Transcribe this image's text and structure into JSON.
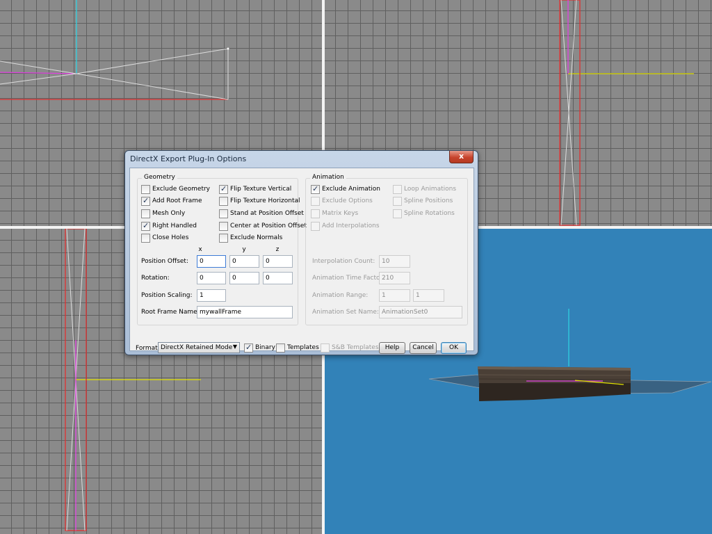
{
  "dialog": {
    "title": "DirectX Export Plug-In Options",
    "close_glyph": "x"
  },
  "geometry": {
    "label": "Geometry",
    "options": [
      {
        "label": "Exclude Geometry",
        "checked": false
      },
      {
        "label": "Add Root Frame",
        "checked": true
      },
      {
        "label": "Mesh Only",
        "checked": false
      },
      {
        "label": "Right Handled",
        "checked": true
      },
      {
        "label": "Close Holes",
        "checked": false
      },
      {
        "label": "Flip Texture Vertical",
        "checked": true
      },
      {
        "label": "Flip Texture Horizontal",
        "checked": false
      },
      {
        "label": "Stand at Position Offset",
        "checked": false
      },
      {
        "label": "Center at Position Offset",
        "checked": false
      },
      {
        "label": "Exclude Normals",
        "checked": false
      }
    ],
    "axes": {
      "x": "x",
      "y": "y",
      "z": "z"
    },
    "position_offset": {
      "label": "Position Offset:",
      "x": "0",
      "y": "0",
      "z": "0"
    },
    "rotation": {
      "label": "Rotation:",
      "x": "0",
      "y": "0",
      "z": "0"
    },
    "position_scaling": {
      "label": "Position Scaling:",
      "value": "1"
    },
    "root_frame_name": {
      "label": "Root Frame Name:",
      "value": "mywallFrame"
    }
  },
  "animation": {
    "label": "Animation",
    "options": [
      {
        "label": "Exclude Animation",
        "checked": true,
        "enabled": true
      },
      {
        "label": "Exclude Options",
        "checked": false,
        "enabled": false
      },
      {
        "label": "Matrix Keys",
        "checked": false,
        "enabled": false
      },
      {
        "label": "Add Interpolations",
        "checked": false,
        "enabled": false
      },
      {
        "label": "Loop Animations",
        "checked": false,
        "enabled": false
      },
      {
        "label": "Spline Positions",
        "checked": false,
        "enabled": false
      },
      {
        "label": "Spline Rotations",
        "checked": false,
        "enabled": false
      }
    ],
    "interpolation_count": {
      "label": "Interpolation Count:",
      "value": "10"
    },
    "animation_time_factor": {
      "label": "Animation Time Factor:",
      "value": "210"
    },
    "animation_range": {
      "label": "Animation Range:",
      "start": "1",
      "end": "1"
    },
    "animation_set_name": {
      "label": "Animation Set Name:",
      "value": "AnimationSet0"
    }
  },
  "footer": {
    "format_label": "Format:",
    "format_value": "DirectX Retained Mode",
    "binary": {
      "label": "Binary",
      "checked": true,
      "enabled": true
    },
    "templates": {
      "label": "Templates",
      "checked": false,
      "enabled": true
    },
    "sb_templates": {
      "label": "S&B Templates",
      "checked": false,
      "enabled": false
    },
    "help_label": "Help",
    "cancel_label": "Cancel",
    "ok_label": "OK"
  },
  "icons": {
    "dropdown": "chevron-down-icon",
    "close": "close-icon",
    "check": "checkmark-icon"
  },
  "colors": {
    "viewport_grid": "#8a8a8a",
    "viewport_3d": "#3282b8",
    "axis_x": "#e03030",
    "axis_y": "#e0e000",
    "axis_z": "#30d0e0",
    "selection": "#e040e0"
  }
}
